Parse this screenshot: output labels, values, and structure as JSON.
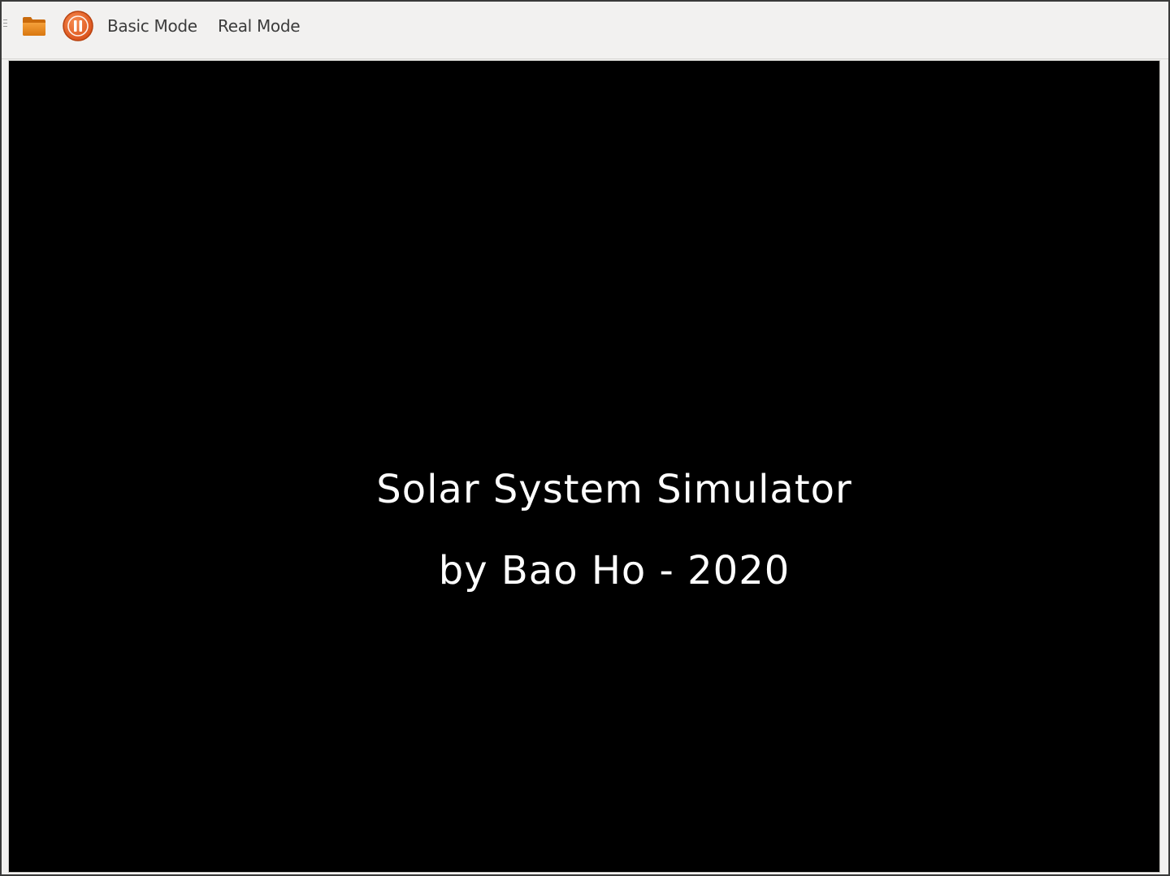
{
  "toolbar": {
    "icons": {
      "open": "folder-icon",
      "pause": "pause-icon"
    },
    "colors": {
      "folder": "#e8871e",
      "pause": "#e8622a"
    },
    "menu": [
      {
        "label": "Basic Mode"
      },
      {
        "label": "Real Mode"
      }
    ]
  },
  "canvas": {
    "background": "#000000",
    "title": "Solar System Simulator",
    "credit": "by Bao Ho - 2020"
  }
}
